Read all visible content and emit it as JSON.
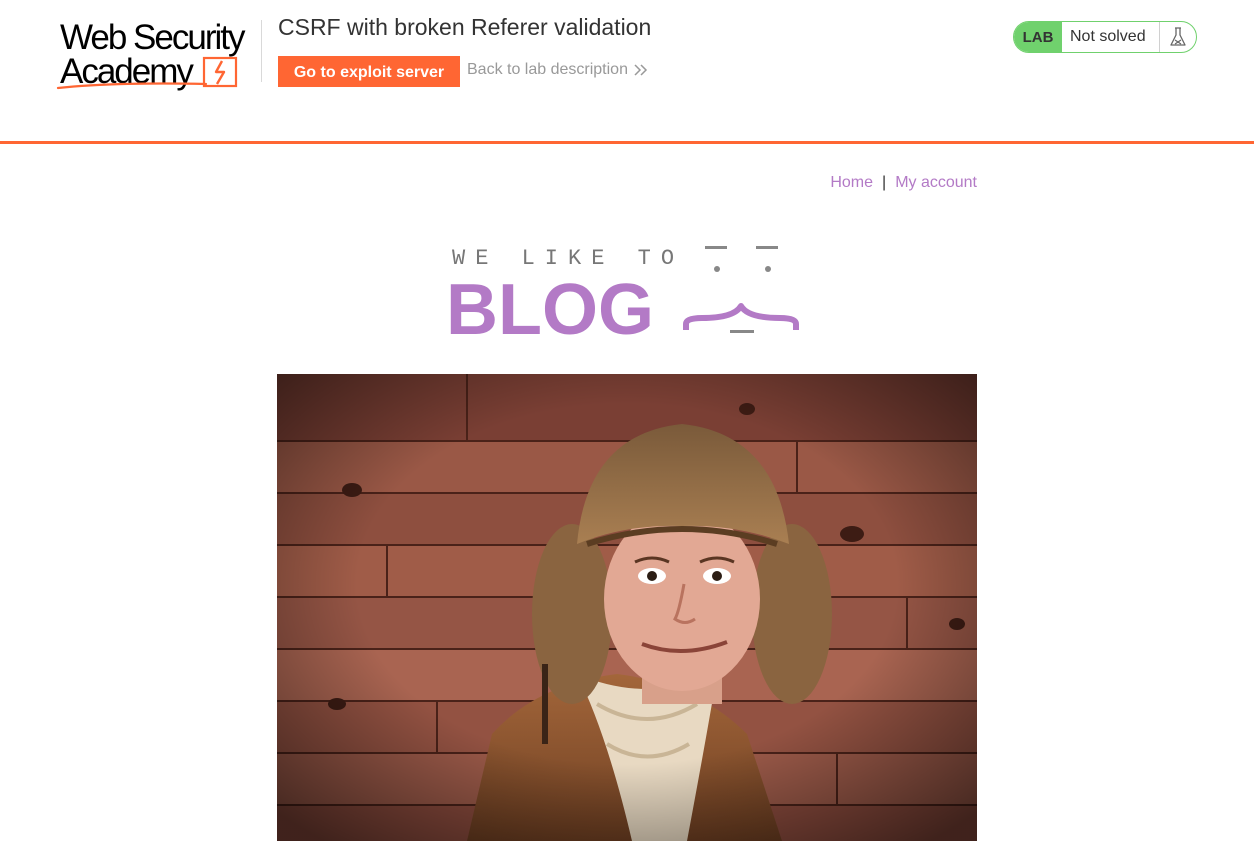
{
  "header": {
    "logo_line1": "Web Security",
    "logo_line2": "Academy",
    "lab_title": "CSRF with broken Referer validation",
    "exploit_button": "Go to exploit server",
    "back_link": "Back to lab description",
    "lab_badge": "LAB",
    "lab_status": "Not solved",
    "accent_color": "#ff6633",
    "status_color": "#70d16d"
  },
  "nav": {
    "home": "Home",
    "separator": "|",
    "my_account": "My account",
    "link_color": "#b37ac6"
  },
  "banner": {
    "tagline": "WE LIKE TO",
    "word": "BLOG"
  },
  "hero": {
    "image_icon": "man-in-fur-hat-photo"
  }
}
